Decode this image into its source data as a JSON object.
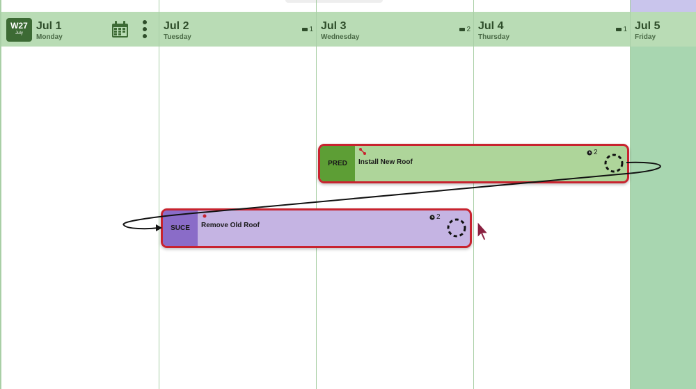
{
  "week": {
    "number": "W27",
    "month": "July"
  },
  "days": [
    {
      "date": "Jul 1",
      "name": "Monday",
      "count": ""
    },
    {
      "date": "Jul 2",
      "name": "Tuesday",
      "count": "1"
    },
    {
      "date": "Jul 3",
      "name": "Wednesday",
      "count": "2"
    },
    {
      "date": "Jul 4",
      "name": "Thursday",
      "count": "1"
    },
    {
      "date": "Jul 5",
      "name": "Friday",
      "count": ""
    }
  ],
  "tasks": [
    {
      "tag": "PRED",
      "title": "Install New Roof",
      "duration": "2",
      "color": "#aed59a",
      "tag_color": "#5d9e35"
    },
    {
      "tag": "SUCE",
      "title": "Remove Old Roof",
      "duration": "2",
      "color": "#c5b4e3",
      "tag_color": "#8a6cc8"
    }
  ],
  "colors": {
    "header": "#b9dcb5",
    "friday": "#a8d6b0",
    "task_border": "#c8232f",
    "cursor": "#8a2040"
  }
}
